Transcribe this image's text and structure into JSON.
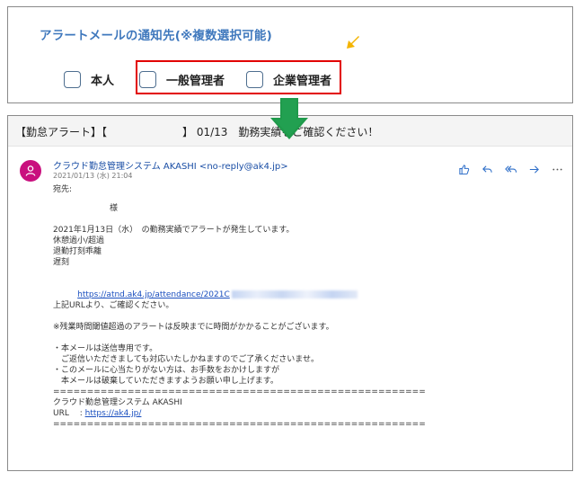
{
  "settings": {
    "title": "アラートメールの通知先(※複数選択可能)",
    "options": [
      {
        "label": "本人",
        "checked": false
      },
      {
        "label": "一般管理者",
        "checked": false
      },
      {
        "label": "企業管理者",
        "checked": false
      }
    ]
  },
  "email": {
    "subject": "【勤怠アラート】【　　　　　　　】 01/13　勤務実績をご確認ください！",
    "avatar_icon": "person-icon",
    "sender": "クラウド勤怠管理システム AKASHI <no-reply@ak4.jp>",
    "datetime": "2021/01/13 (水) 21:04",
    "to_label": "宛先:",
    "actions": [
      "like-icon",
      "reply-icon",
      "reply-all-icon",
      "forward-icon",
      "more-icon"
    ],
    "body": {
      "salutation": "　　　　　　　様",
      "intro": "2021年1月13日（水）　の勤務実績でアラートが発生しています。",
      "alerts": [
        "休憩過小/超過",
        "退勤打刻乖離",
        "遅刻"
      ],
      "url": "https://atnd.ak4.jp/attendance/2021C",
      "check_url": "上記URLより、ご確認ください。",
      "note": "※残業時間閾値超過のアラートは反映までに時間がかかることがございます。",
      "footer": [
        "・本メールは送信専用です。",
        "　ご返信いただきましても対応いたしかねますのでご了承くださいませ。",
        "・このメールに心当たりがない方は、お手数をおかけしますが",
        "　本メールは破棄していただきますようお願い申し上げます。"
      ],
      "separator": "=======================================================",
      "sig_name": "クラウド勤怠管理システム AKASHI",
      "sig_url_label": "URL　 : ",
      "sig_url": "https://ak4.jp/"
    }
  },
  "colors": {
    "title_blue": "#3f78bd",
    "highlight_red": "#e20000",
    "arrow_green": "#1f9a4b",
    "arrow_yellow": "#f4b400",
    "avatar_magenta": "#c90f7e",
    "link_blue": "#1a4fbf"
  }
}
